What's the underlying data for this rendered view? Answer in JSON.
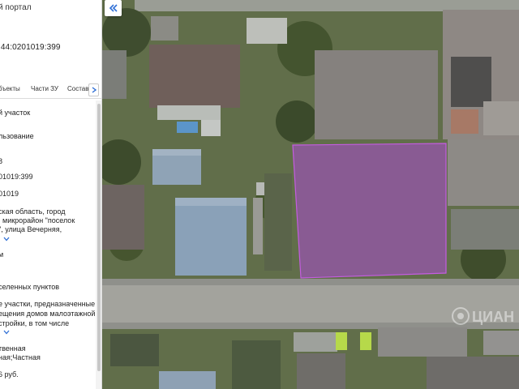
{
  "panel": {
    "portal_title": "й портал",
    "cadastral_number": ":44:0201019:399",
    "tabs": [
      {
        "label": "бъекты"
      },
      {
        "label": "Части ЗУ"
      },
      {
        "label": "Состав"
      }
    ],
    "rows": [
      {
        "text": "й участок"
      },
      {
        "text": "льзование"
      },
      {
        "text": "8"
      },
      {
        "text": "01019:399"
      },
      {
        "text": "01019"
      },
      {
        "text": "ская область, город"
      },
      {
        "text": ", микрорайон \"поселок"
      },
      {
        "text": "\", улица Вечерняя,"
      },
      {
        "text": "м"
      },
      {
        "text": "селенных пунктов"
      },
      {
        "text": "е участки, предназначенные"
      },
      {
        "text": "ещения домов малоэтажной"
      },
      {
        "text": "стройки, в том числе"
      },
      {
        "text": "твенная"
      },
      {
        "text": "ная;Частная"
      },
      {
        "text": "6 руб."
      }
    ]
  },
  "map": {
    "parcel_fill": "#a14fc0",
    "parcel_stroke": "#c45ce0",
    "watermark_text": "ЦИАН"
  },
  "icons": {
    "collapse": "double-chevron-left-icon",
    "tab_scroll": "chevron-right-icon",
    "expand": "chevron-down-icon"
  },
  "colors": {
    "accent": "#2f6fd6"
  }
}
